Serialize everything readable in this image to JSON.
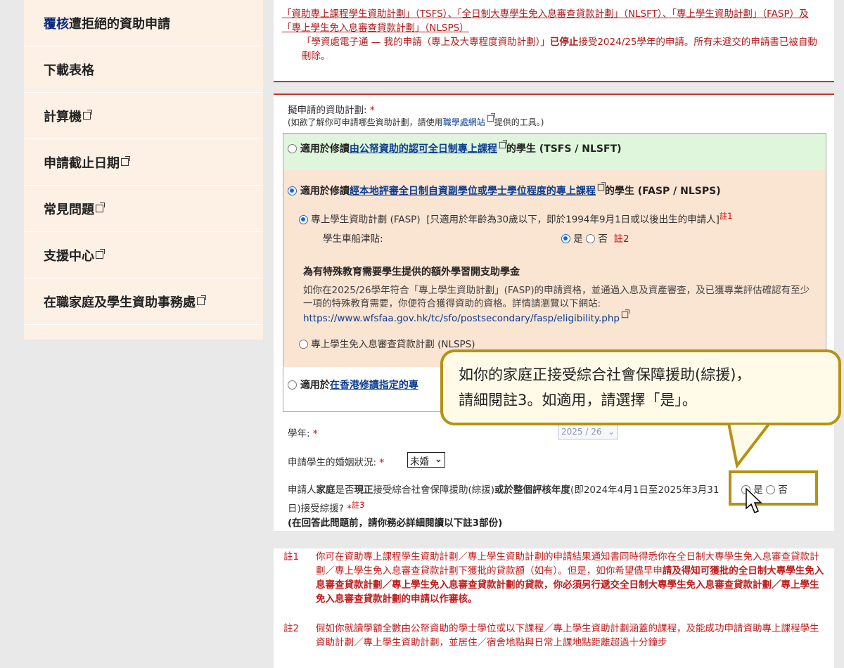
{
  "sidebar": {
    "items": [
      {
        "label_hl": "覆核",
        "label": "遭拒絕的資助申請",
        "external": false
      },
      {
        "label_hl": "",
        "label": "下載表格",
        "external": false
      },
      {
        "label_hl": "",
        "label": "計算機",
        "external": true
      },
      {
        "label_hl": "",
        "label": "申請截止日期",
        "external": true
      },
      {
        "label_hl": "",
        "label": "常見問題",
        "external": true
      },
      {
        "label_hl": "",
        "label": "支援中心",
        "external": true
      },
      {
        "label_hl": "",
        "label": "在職家庭及學生資助事務處",
        "external": true
      }
    ]
  },
  "notice": {
    "line1": "「資助專上課程學生資助計劃」（TSFS）、「全日制大專學生免入息審查貸款計劃」（NLSFT）、「專上學生資助計劃」（FASP）及「專上學生免入息審查貸款計劃」（NLSPS）",
    "line2_a": "「學資處電子通 — 我的申請（專上及大專程度資助計劃）」",
    "line2_b": "已停止",
    "line2_c": "接受2024/25學年的申請。所有未遞交的申請書已被自動刪除。"
  },
  "form": {
    "scheme_label": "擬申請的資助計劃:",
    "scheme_hint_a": "(如欲了解你可申請哪些資助計劃，請使用",
    "scheme_hint_link": "職學處網站",
    "scheme_hint_b": "提供的工具。)",
    "opt1_prefix": "適用於修讀",
    "opt1_link": "由公帑資助的認可全日制專上課程",
    "opt1_suffix": "的學生 (TSFS / NLSFT)",
    "opt2_prefix": "適用於修讀",
    "opt2_link": "經本地評審全日制自資副學位或學士學位程度的專上課程",
    "opt2_suffix": "的學生 (FASP / NLSPS)",
    "fasp_label": "專上學生資助計劃 (FASP)",
    "fasp_note": "[只適用於年齡為30歲以下，即於1994年9月1日或以後出生的申請人]",
    "fasp_sup": "註1",
    "travel_label": "學生車船津貼:",
    "yes": "是",
    "no": "否",
    "travel_sup": "註2",
    "sen_title": "為有特殊教育需要學生提供的額外學習開支助學金",
    "sen_text": "如你在2025/26學年符合「專上學生資助計劃」(FASP)的申請資格，並通過入息及資產審查，及已獲專業評估確認有至少一項的特殊教育需要，你便符合獲得資助的資格。詳情請瀏覽以下網站:",
    "sen_link": "https://www.wfsfaa.gov.hk/tc/sfo/postsecondary/fasp/eligibility.php",
    "nlsps_label": "專上學生免入息審查貸款計劃 (NLSPS)",
    "opt3_prefix": "適用於",
    "opt3_link": "在香港修讀指定的專",
    "year_label": "學年:",
    "year_value": "2025 / 26",
    "marital_label": "申請學生的婚姻狀況:",
    "marital_value": "未婚",
    "cssa_q_a": "申請人",
    "cssa_q_b": "家庭",
    "cssa_q_c": "是否",
    "cssa_q_d": "現正",
    "cssa_q_e": "接受綜合社會保障援助(綜援)",
    "cssa_q_f": "或於",
    "cssa_q_g": "整個評核年度",
    "cssa_q_h": "(即2024年4月1日至2025年3月31日)接受綜援?",
    "cssa_sup": "註3",
    "cssa_warn": "(在回答此問題前，請你務必詳細閱讀以下註3部份)"
  },
  "tooltip": {
    "line1": "如你的家庭正接受綜合社會保障援助(綜援)，",
    "line2": "請細閱註3。如適用，請選擇「是」。"
  },
  "notes": [
    {
      "id": "註1",
      "text_a": "你可在資助專上課程學生資助計劃／專上學生資助計劃的申請結果通知書同時得悉你在全日制大專學生免入息審查貸款計劃／專上學生免入息審查貸款計劃下獲批的貸款額（如有）。但是，如你希望儘早申",
      "text_b": "請及得知可獲批的全日制大專學生免入息審查貸款計劃／專上學生免入息審查貸款計劃的貸款，你必須另行遞交全日制大專學生免入息審查貸款計劃／專上學生免入息審查貸款計劃的申請以作審核。"
    },
    {
      "id": "註2",
      "text_a": "假如你就讀學額全數由公帑資助的學士學位或以下課程／專上學生資助計劃涵蓋的課程，及能成功申請資助專上課程學生資助計劃／專上學生資助計劃，並居住／宿舍地點與日常上課地點距離超過十分鐘步",
      "text_b": ""
    }
  ]
}
